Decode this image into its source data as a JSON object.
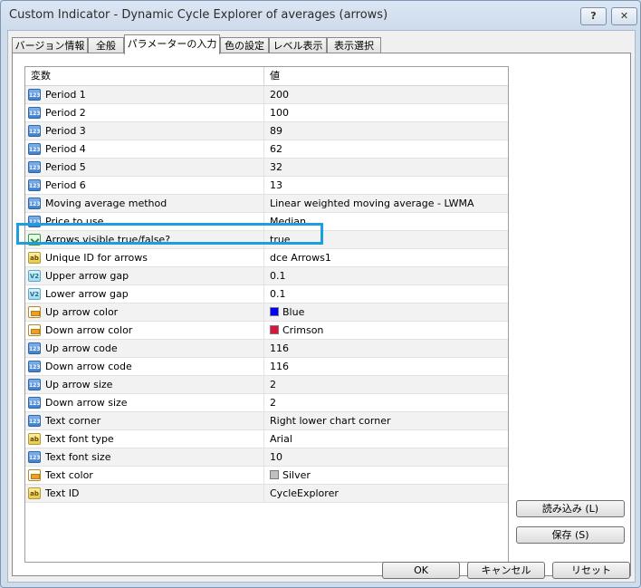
{
  "window": {
    "title": "Custom Indicator - Dynamic Cycle Explorer of averages (arrows)",
    "help_label": "?",
    "close_label": "✕"
  },
  "tabs": [
    {
      "label": "バージョン情報"
    },
    {
      "label": "全般"
    },
    {
      "label": "パラメーターの入力",
      "active": true
    },
    {
      "label": "色の設定"
    },
    {
      "label": "レベル表示"
    },
    {
      "label": "表示選択"
    }
  ],
  "grid": {
    "col_variable": "変数",
    "col_value": "値",
    "rows": [
      {
        "icon": "123",
        "name": "Period 1",
        "value": "200"
      },
      {
        "icon": "123",
        "name": "Period 2",
        "value": "100"
      },
      {
        "icon": "123",
        "name": "Period 3",
        "value": "89"
      },
      {
        "icon": "123",
        "name": "Period 4",
        "value": "62"
      },
      {
        "icon": "123",
        "name": "Period 5",
        "value": "32"
      },
      {
        "icon": "123",
        "name": "Period 6",
        "value": "13"
      },
      {
        "icon": "123",
        "name": "Moving average method",
        "value": "Linear weighted moving average - LWMA"
      },
      {
        "icon": "123",
        "name": "Price to use",
        "value": "Median"
      },
      {
        "icon": "bool",
        "name": "Arrows visible true/false?",
        "value": "true"
      },
      {
        "icon": "ab",
        "name": "Unique ID for arrows",
        "value": "dce Arrows1"
      },
      {
        "icon": "v2",
        "name": "Upper arrow gap",
        "value": "0.1"
      },
      {
        "icon": "v2",
        "name": "Lower arrow gap",
        "value": "0.1"
      },
      {
        "icon": "color",
        "name": "Up arrow color",
        "value": "Blue",
        "swatch": "#0000ff"
      },
      {
        "icon": "color",
        "name": "Down arrow color",
        "value": "Crimson",
        "swatch": "#dc143c"
      },
      {
        "icon": "123",
        "name": "Up arrow code",
        "value": "116"
      },
      {
        "icon": "123",
        "name": "Down arrow code",
        "value": "116"
      },
      {
        "icon": "123",
        "name": "Up arrow size",
        "value": "2"
      },
      {
        "icon": "123",
        "name": "Down arrow size",
        "value": "2"
      },
      {
        "icon": "123",
        "name": "Text corner",
        "value": "Right lower chart corner"
      },
      {
        "icon": "ab",
        "name": "Text font type",
        "value": "Arial"
      },
      {
        "icon": "123",
        "name": "Text font size",
        "value": "10"
      },
      {
        "icon": "color",
        "name": "Text color",
        "value": "Silver",
        "swatch": "#c0c0c0"
      },
      {
        "icon": "ab",
        "name": "Text ID",
        "value": "CycleExplorer"
      }
    ]
  },
  "side_buttons": {
    "load_label": "読み込み (L)",
    "save_label": "保存 (S)"
  },
  "footer": {
    "ok_label": "OK",
    "cancel_label": "キャンセル",
    "reset_label": "リセット"
  },
  "icons": {
    "123": "integer-icon",
    "ab": "string-icon",
    "v2": "double-icon",
    "color": "color-icon",
    "bool": "boolean-icon"
  },
  "highlight_color": "#1e9ee0"
}
